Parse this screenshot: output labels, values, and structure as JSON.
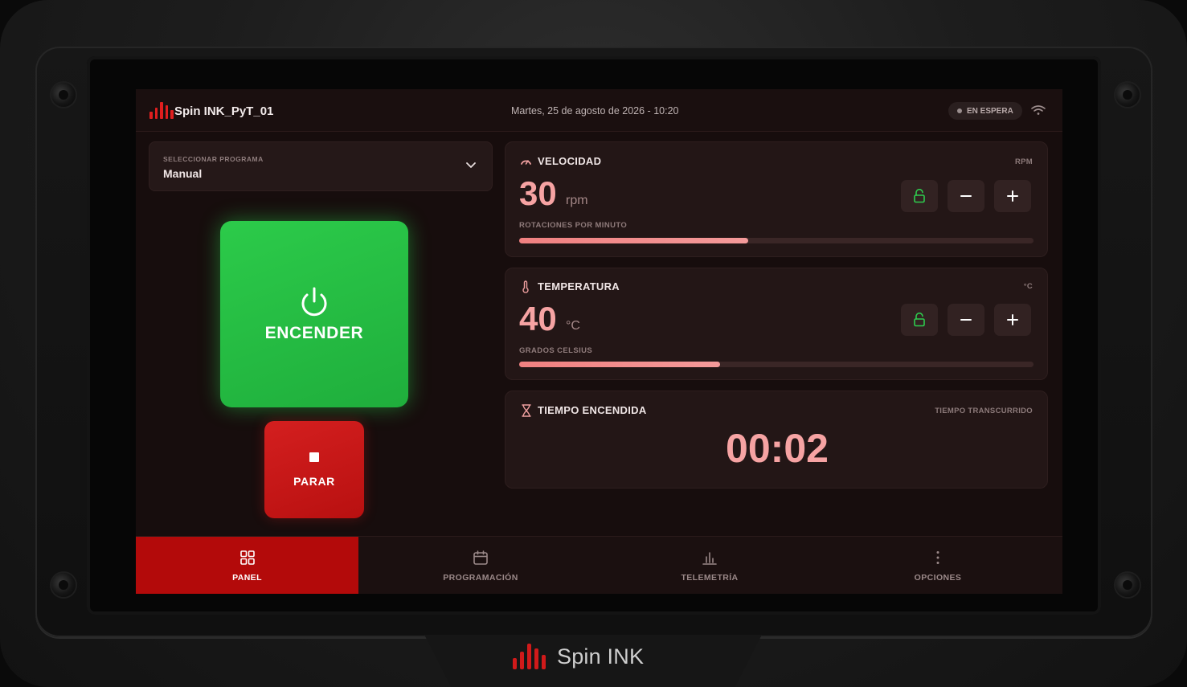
{
  "device": {
    "brand": "Spin INK"
  },
  "header": {
    "device_name": "Spin INK_PyT_01",
    "datetime": "Martes, 25 de agosto de 2026 - 10:20",
    "status": "EN ESPERA",
    "icons": {
      "logo": "bars-logo-icon",
      "wifi": "wifi-icon"
    }
  },
  "program": {
    "label": "SELECCIONAR PROGRAMA",
    "value": "Manual"
  },
  "controls": {
    "on_label": "ENCENDER",
    "stop_label": "PARAR"
  },
  "speed": {
    "title": "VELOCIDAD",
    "unit_top": "RPM",
    "value": "30",
    "unit": "rpm",
    "sublabel": "ROTACIONES POR MINUTO",
    "level": 0.445
  },
  "temperature": {
    "title": "TEMPERATURA",
    "unit_top": "°C",
    "value": "40",
    "unit": "°C",
    "sublabel": "GRADOS CELSIUS",
    "level": 0.39
  },
  "timer": {
    "title": "TIEMPO ENCENDIDA",
    "caption": "TIEMPO TRANSCURRIDO",
    "value": "00:02"
  },
  "tabs": [
    {
      "label": "PANEL",
      "icon": "grid-icon",
      "active": true
    },
    {
      "label": "PROGRAMACIÓN",
      "icon": "calendar-icon",
      "active": false
    },
    {
      "label": "TELEMETRÍA",
      "icon": "bar-chart-icon",
      "active": false
    },
    {
      "label": "OPCIONES",
      "icon": "more-vertical-icon",
      "active": false
    }
  ],
  "colors": {
    "accent": "#b30a0a",
    "on": "#2ccb4a",
    "stop": "#d41f1f",
    "value": "#f6a3a3",
    "lock": "#2ecc4e"
  }
}
